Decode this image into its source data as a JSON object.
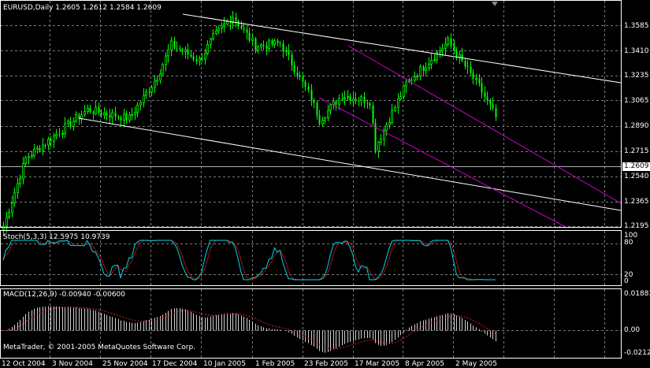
{
  "window": {
    "symbol_header": "EURUSD,Daily  1.2605 1.2612 1.2584 1.2609",
    "copyright": "MetaTrader, © 2001-2005 MetaQuotes Software Corp."
  },
  "colors": {
    "background": "#000000",
    "candles": "#00ff00",
    "grid": "#7a7a7a",
    "trendline": "#ffffff",
    "channel": "#cc00cc",
    "stoch_main": "#00d7e5",
    "stoch_signal": "#e02020",
    "macd_hist": "#d0d0d0",
    "macd_signal": "#e02020"
  },
  "price_axis": {
    "ticks": [
      "1.3585",
      "1.3410",
      "1.3235",
      "1.3065",
      "1.2890",
      "1.2715",
      "1.2540",
      "1.2365",
      "1.2195"
    ],
    "current": "1.2609"
  },
  "stoch": {
    "label": "Stoch(5,3,3)  12.5975  10.9739",
    "axis": [
      "100",
      "80",
      "20",
      "0"
    ]
  },
  "macd": {
    "label": "MACD(12,26,9) -0.00940 -0.00600",
    "axis": [
      "0.01883",
      "0.00",
      "-0.02128"
    ]
  },
  "date_axis": [
    "12 Oct 2004",
    "3 Nov 2004",
    "25 Nov 2004",
    "17 Dec 2004",
    "10 Jan 2005",
    "1 Feb 2005",
    "23 Feb 2005",
    "17 Mar 2005",
    "8 Apr 2005",
    "2 May 2005"
  ],
  "chart_data": {
    "type": "line",
    "title": "EURUSD,Daily",
    "price_anchors": {
      "x": [
        0,
        8,
        30,
        45,
        55,
        60,
        70,
        75,
        82,
        90,
        99,
        110,
        113,
        121,
        131,
        133,
        144,
        159,
        170,
        176
      ],
      "y": [
        1.2195,
        1.2665,
        1.3,
        1.294,
        1.323,
        1.345,
        1.334,
        1.35,
        1.365,
        1.344,
        1.346,
        1.308,
        1.293,
        1.31,
        1.306,
        1.274,
        1.318,
        1.347,
        1.316,
        1.295
      ]
    }
  }
}
